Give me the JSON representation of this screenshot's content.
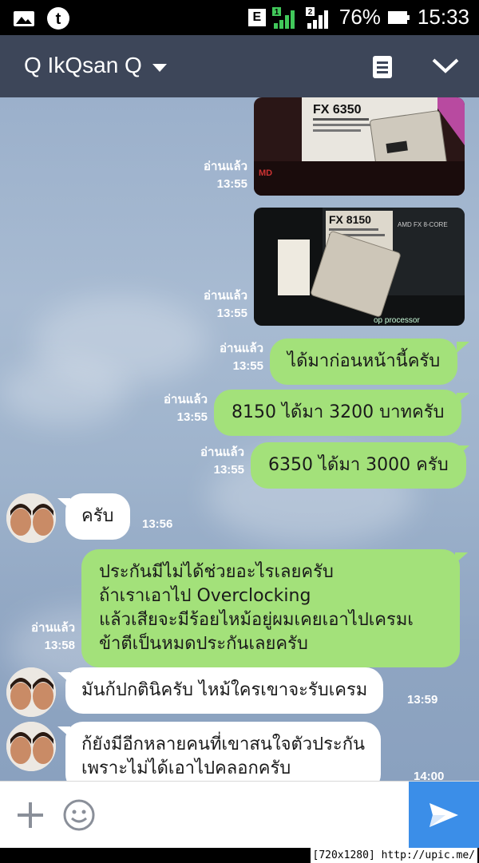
{
  "status_bar": {
    "network_badge": "E",
    "sim1": "1",
    "sim2": "2",
    "battery": "76%",
    "time": "15:33"
  },
  "header": {
    "title": "Q IkQsan Q"
  },
  "messages": {
    "photo1": {
      "read": "อ่านแล้ว",
      "time": "13:55",
      "box_label": "FX 6350"
    },
    "photo2": {
      "read": "อ่านแล้ว",
      "time": "13:55",
      "box_label": "FX 8150",
      "box_side": "AMD FX 8-CORE",
      "box_caption": "op processor"
    },
    "m1": {
      "text": "ได้มาก่อนหน้านี้ครับ",
      "read": "อ่านแล้ว",
      "time": "13:55"
    },
    "m2": {
      "text": "8150 ได้มา 3200 บาทครับ",
      "read": "อ่านแล้ว",
      "time": "13:55"
    },
    "m3": {
      "text": "6350 ได้มา 3000 ครับ",
      "read": "อ่านแล้ว",
      "time": "13:55"
    },
    "r1": {
      "text": "ครับ",
      "time": "13:56"
    },
    "m4": {
      "line1": "ประกันมีไม่ได้ช่วยอะไรเลยครับ",
      "line2": "ถ้าเราเอาไป Overclocking",
      "line3": "แล้วเสียจะมีร้อยไหม้อยู่ผมเคยเอาไปเครมเ",
      "line4": "ข้าตีเป็นหมดประกันเลยครับ",
      "read": "อ่านแล้ว",
      "time": "13:58"
    },
    "r2": {
      "text": "มันก้ปกตินิครับ ไหม้ใครเขาจะรับเครม",
      "time": "13:59"
    },
    "r3": {
      "line1": "ก้ยังมีอีกหลายคนที่เขาสนใจตัวประกัน",
      "line2": "เพราะไม่ได้เอาไปคลอกครับ",
      "time": "14:00"
    }
  },
  "watermark": "[720x1280] http://upic.me/",
  "colors": {
    "header_bg": "#3d4659",
    "outgoing_bubble": "#a3e17a",
    "incoming_bubble": "#ffffff",
    "send_button": "#3b8ee8"
  },
  "icons": [
    "gallery-icon",
    "tumblr-icon",
    "signal-icon",
    "battery-icon",
    "note-icon",
    "chevron-down-icon",
    "plus-icon",
    "smiley-icon",
    "send-icon"
  ]
}
